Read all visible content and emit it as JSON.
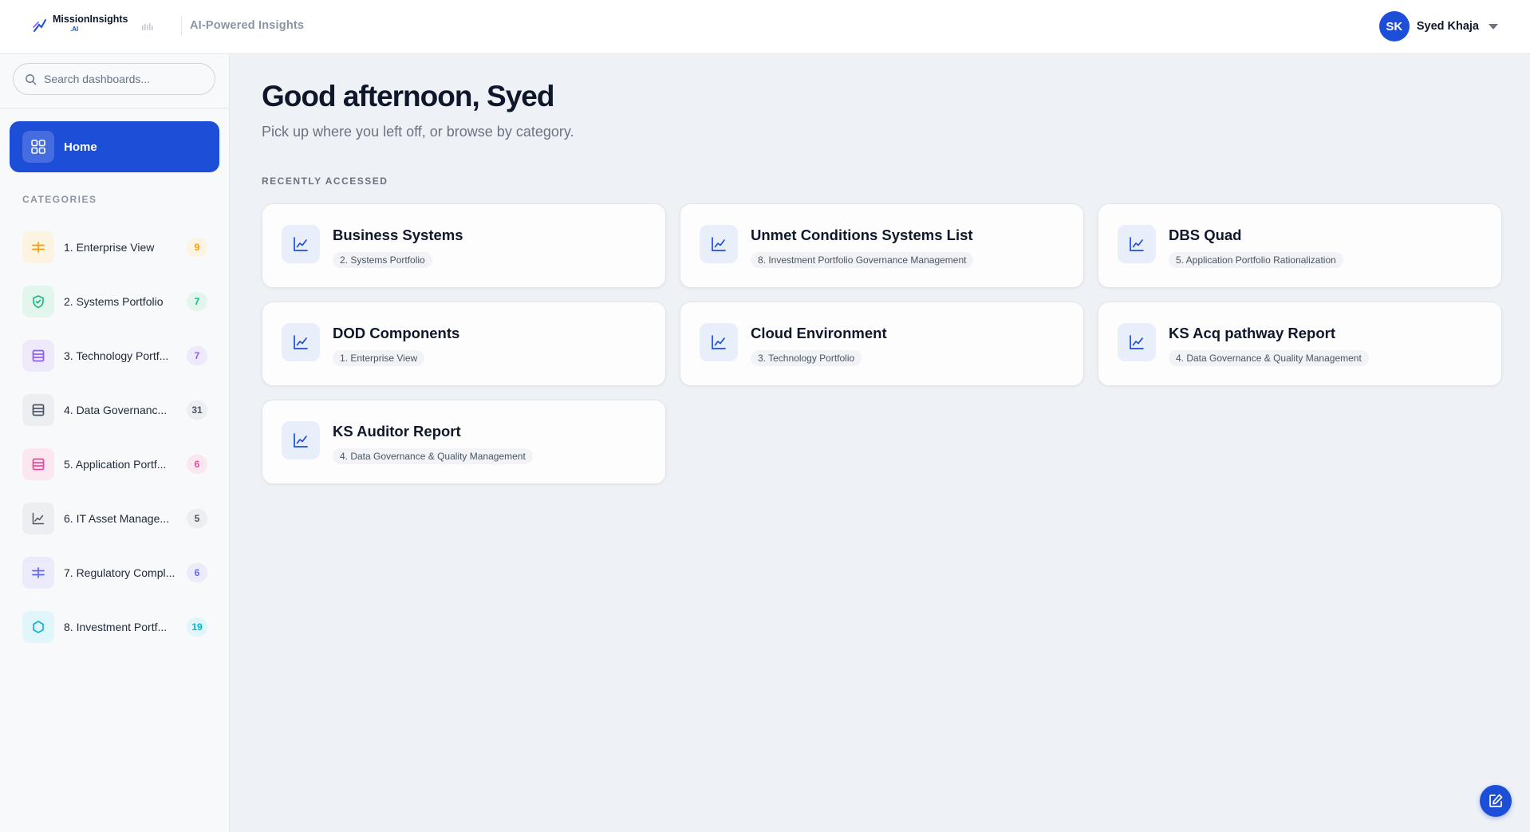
{
  "header": {
    "logo_title": "MissionInsights",
    "logo_sub": ".AI",
    "tagline": "AI-Powered Insights",
    "user_initials": "SK",
    "user_name": "Syed Khaja"
  },
  "sidebar": {
    "search_placeholder": "Search dashboards...",
    "home_label": "Home",
    "categories_heading": "CATEGORIES",
    "categories": [
      {
        "label": "1. Enterprise View",
        "count": "9",
        "icon": "sliders-icon",
        "color": "#f59e0b",
        "bg": "#fdf3e1",
        "badge_bg": "#fdf3e1"
      },
      {
        "label": "2. Systems Portfolio",
        "count": "7",
        "icon": "shield-icon",
        "color": "#10b981",
        "bg": "#e3f6ee",
        "badge_bg": "#e3f6ee"
      },
      {
        "label": "3. Technology Portf...",
        "count": "7",
        "icon": "database-icon",
        "color": "#8b5cf6",
        "bg": "#efe9fc",
        "badge_bg": "#efe9fc"
      },
      {
        "label": "4. Data Governanc...",
        "count": "31",
        "icon": "database-icon",
        "color": "#4b5563",
        "bg": "#eceef1",
        "badge_bg": "#eceef1"
      },
      {
        "label": "5. Application Portf...",
        "count": "6",
        "icon": "database-icon",
        "color": "#ec4899",
        "bg": "#fce7f1",
        "badge_bg": "#fce7f1"
      },
      {
        "label": "6. IT Asset Manage...",
        "count": "5",
        "icon": "chart-line-icon",
        "color": "#4b5563",
        "bg": "#eceef1",
        "badge_bg": "#eceef1"
      },
      {
        "label": "7. Regulatory Compl...",
        "count": "6",
        "icon": "sliders-icon",
        "color": "#6366f1",
        "bg": "#ebebfb",
        "badge_bg": "#ebebfb"
      },
      {
        "label": "8. Investment Portf...",
        "count": "19",
        "icon": "hexagon-icon",
        "color": "#06b6d4",
        "bg": "#e0f6fa",
        "badge_bg": "#e0f6fa"
      }
    ]
  },
  "main": {
    "greeting": "Good afternoon, Syed",
    "subtitle": "Pick up where you left off, or browse by category.",
    "section_label": "RECENTLY ACCESSED",
    "cards": [
      {
        "title": "Business Systems",
        "tag": "2. Systems Portfolio"
      },
      {
        "title": "Unmet Conditions Systems List",
        "tag": "8. Investment Portfolio Governance Management"
      },
      {
        "title": "DBS Quad",
        "tag": "5. Application Portfolio Rationalization"
      },
      {
        "title": "DOD Components",
        "tag": "1. Enterprise View"
      },
      {
        "title": "Cloud Environment",
        "tag": "3. Technology Portfolio"
      },
      {
        "title": "KS Acq pathway Report",
        "tag": "4. Data Governance & Quality Management"
      },
      {
        "title": "KS Auditor Report",
        "tag": "4. Data Governance & Quality Management"
      }
    ]
  },
  "colors": {
    "accent": "#1d4ed8"
  }
}
